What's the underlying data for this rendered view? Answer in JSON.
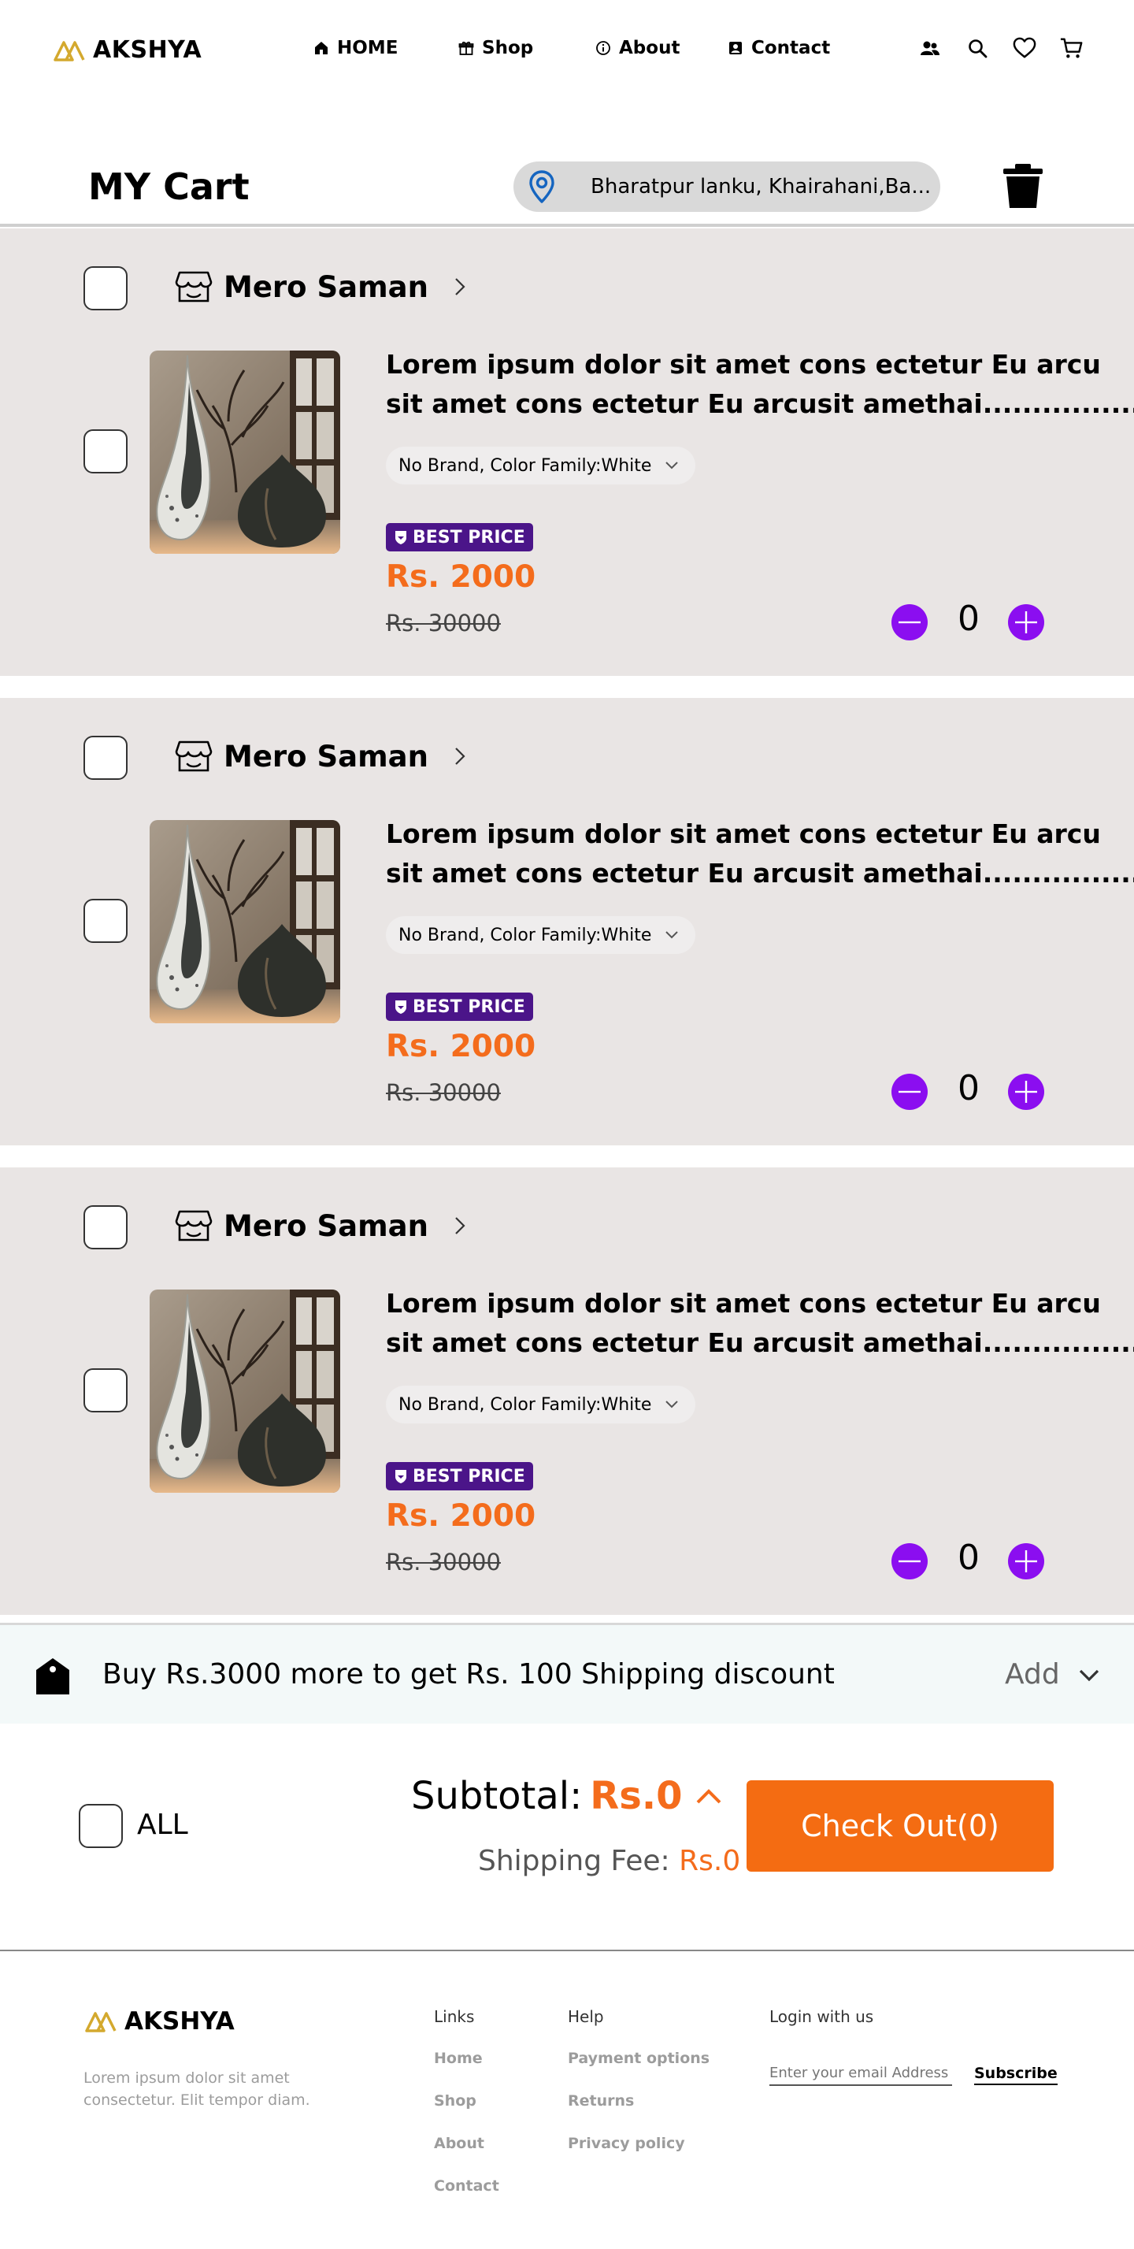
{
  "brand": {
    "name": "AKSHYA",
    "accent": "#d4a92e"
  },
  "nav": {
    "links": [
      {
        "label": "HOME",
        "icon": "home-icon"
      },
      {
        "label": "Shop",
        "icon": "gift-icon"
      },
      {
        "label": "About",
        "icon": "info-icon"
      },
      {
        "label": "Contact",
        "icon": "contact-icon"
      }
    ],
    "icons": [
      "users-icon",
      "search-icon",
      "heart-icon",
      "cart-icon"
    ]
  },
  "cart": {
    "title": "MY Cart",
    "address": "Bharatpur lanku, Khairahani,Ba....",
    "items": [
      {
        "store": "Mero Saman",
        "title_line1": "Lorem ipsum dolor sit amet cons ectetur Eu arcu",
        "title_line2": "sit amet cons ectetur Eu arcusit amethai................",
        "variant": "No Brand, Color Family:White",
        "badge": "BEST PRICE",
        "price": "Rs. 2000",
        "old_price": "Rs. 30000",
        "qty": "0"
      },
      {
        "store": "Mero Saman",
        "title_line1": "Lorem ipsum dolor sit amet cons ectetur Eu arcu",
        "title_line2": "sit amet cons ectetur Eu arcusit amethai................",
        "variant": "No Brand, Color Family:White",
        "badge": "BEST PRICE",
        "price": "Rs. 2000",
        "old_price": "Rs. 30000",
        "qty": "0"
      },
      {
        "store": "Mero Saman",
        "title_line1": "Lorem ipsum dolor sit amet cons ectetur Eu arcu",
        "title_line2": "sit amet cons ectetur Eu arcusit amethai................",
        "variant": "No Brand, Color Family:White",
        "badge": "BEST PRICE",
        "price": "Rs. 2000",
        "old_price": "Rs. 30000",
        "qty": "0"
      }
    ]
  },
  "shipping_banner": {
    "text": "Buy Rs.3000 more to get Rs. 100 Shipping discount",
    "action": "Add"
  },
  "summary": {
    "all_label": "ALL",
    "subtotal_label": "Subtotal:",
    "subtotal_value": "Rs.0",
    "shipping_label": "Shipping Fee:",
    "shipping_value": "Rs.0",
    "checkout_label": "Check Out(0)"
  },
  "footer": {
    "brand": "AKSHYA",
    "description": "Lorem ipsum dolor sit amet consectetur. Elit tempor diam.",
    "links_title": "Links",
    "links": [
      "Home",
      "Shop",
      "About",
      "Contact"
    ],
    "help_title": "Help",
    "help": [
      "Payment options",
      "Returns",
      "Privacy policy"
    ],
    "login_title": "Login with us",
    "email_placeholder": "Enter your email Address",
    "subscribe_label": "Subscribe"
  },
  "colors": {
    "price": "#f46c1c",
    "checkout": "#f46c12",
    "qty_button": "#8b0ef0",
    "badge": "#4b1589",
    "item_bg": "#e9e5e4"
  }
}
